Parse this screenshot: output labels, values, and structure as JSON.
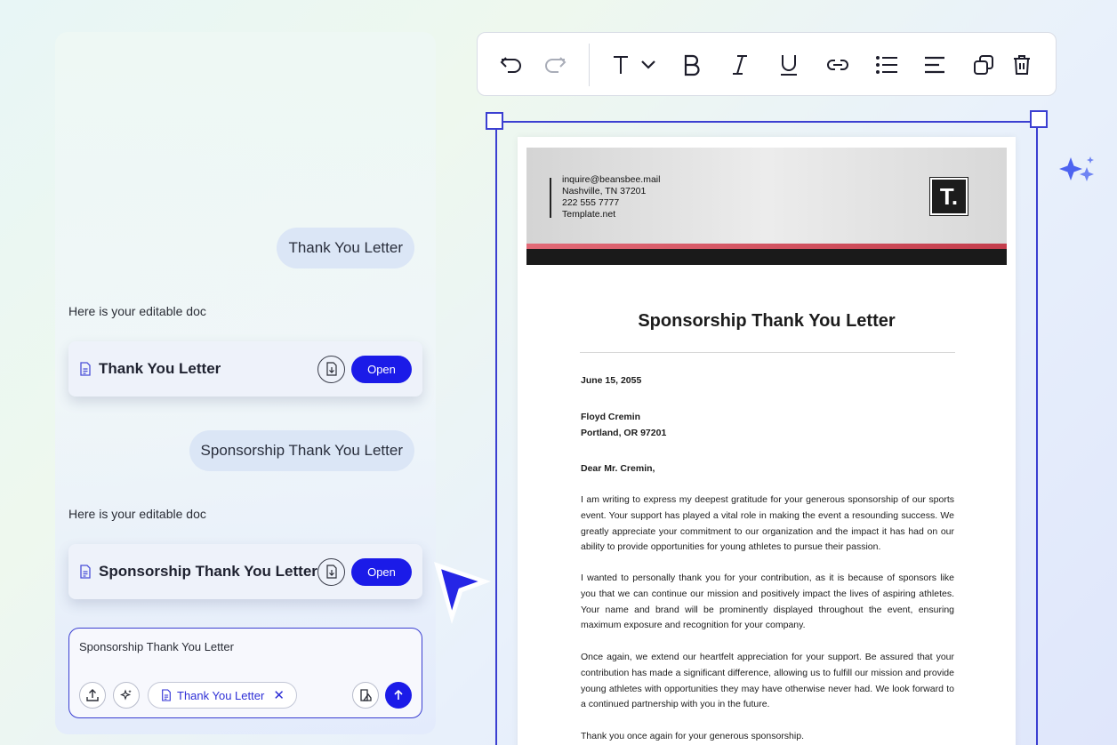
{
  "chat": {
    "messages": [
      {
        "role": "user",
        "text": "Thank You Letter"
      },
      {
        "role": "assistant",
        "text": "Here is your editable doc",
        "doc_title": "Thank You Letter",
        "open_label": "Open"
      },
      {
        "role": "user",
        "text": "Sponsorship Thank You Letter"
      },
      {
        "role": "assistant",
        "text": "Here is your editable doc",
        "doc_title": "Sponsorship Thank You Letter",
        "open_label": "Open"
      }
    ],
    "input": {
      "value": "Sponsorship Thank You Letter",
      "attachment_chip": "Thank You Letter"
    }
  },
  "toolbar": {
    "items": [
      "undo-icon",
      "redo-icon",
      "text-style-icon",
      "bold-icon",
      "italic-icon",
      "underline-icon",
      "link-icon",
      "list-icon",
      "align-icon",
      "duplicate-icon",
      "delete-icon"
    ]
  },
  "document": {
    "header": {
      "email": "inquire@beansbee.mail",
      "address": "Nashville, TN 37201",
      "phone": "222 555 7777",
      "website": "Template.net",
      "logo": "T."
    },
    "title": "Sponsorship Thank You Letter",
    "date": "June 15, 2055",
    "recipient_name": "Floyd Cremin",
    "recipient_address": "Portland, OR 97201",
    "salutation": "Dear Mr. Cremin,",
    "paragraphs": [
      "I am writing to express my deepest gratitude for your generous sponsorship of our sports event. Your support has played a vital role in making the event a resounding success. We greatly appreciate your commitment to our organization and the impact it has had on our ability to provide opportunities for young athletes to pursue their passion.",
      "I wanted to personally thank you for your contribution, as it is because of sponsors like you that we can continue our mission and positively impact the lives of aspiring athletes. Your name and brand will be prominently displayed throughout the event, ensuring maximum exposure and recognition for your company.",
      "Once again, we extend our heartfelt appreciation for your support. Be assured that your contribution has made a significant difference, allowing us to fulfill our mission and provide young athletes with opportunities they may have otherwise never had. We look forward to a continued partnership with you in the future.",
      "Thank you once again for your generous sponsorship."
    ]
  },
  "colors": {
    "accent": "#1b1be8",
    "frame": "#3b3fd1",
    "header_red": "#c43d4c"
  }
}
